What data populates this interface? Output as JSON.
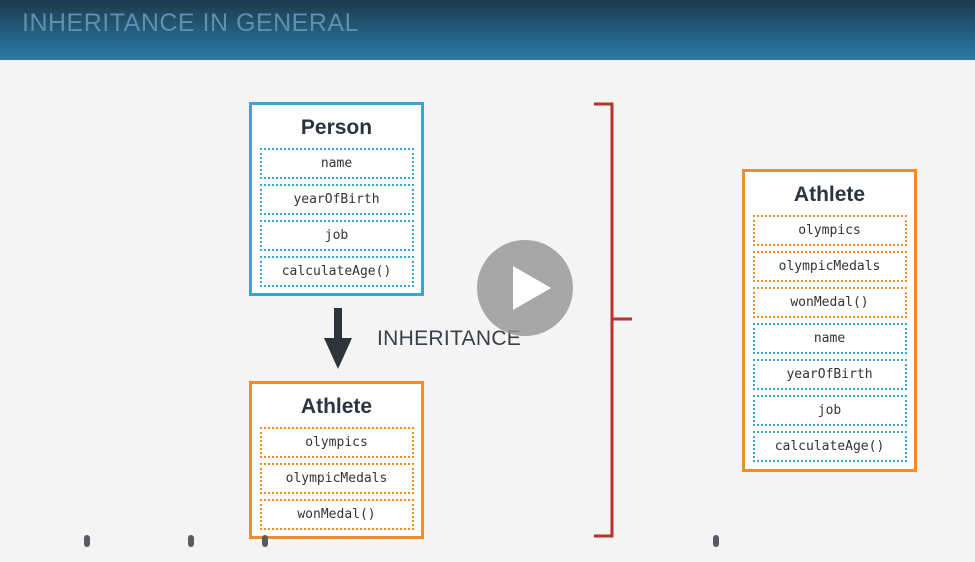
{
  "header": {
    "title": "INHERITANCE IN GENERAL"
  },
  "person_box": {
    "title": "Person",
    "props": [
      "name",
      "yearOfBirth",
      "job",
      "calculateAge()"
    ]
  },
  "athlete_box": {
    "title": "Athlete",
    "props": [
      "olympics",
      "olympicMedals",
      "wonMedal()"
    ]
  },
  "inheritance_label": "INHERITANCE",
  "result_box": {
    "title": "Athlete",
    "props": [
      "olympics",
      "olympicMedals",
      "wonMedal()",
      "name",
      "yearOfBirth",
      "job",
      "calculateAge()"
    ]
  },
  "icons": {
    "play": "play-icon",
    "arrow": "arrow-down-icon",
    "bracket": "right-bracket-icon"
  },
  "colors": {
    "header": "#245e80",
    "person_border": "#3aa4d6",
    "athlete_border": "#f08c2e",
    "bracket": "#b8332a",
    "arrow": "#2f343b"
  }
}
